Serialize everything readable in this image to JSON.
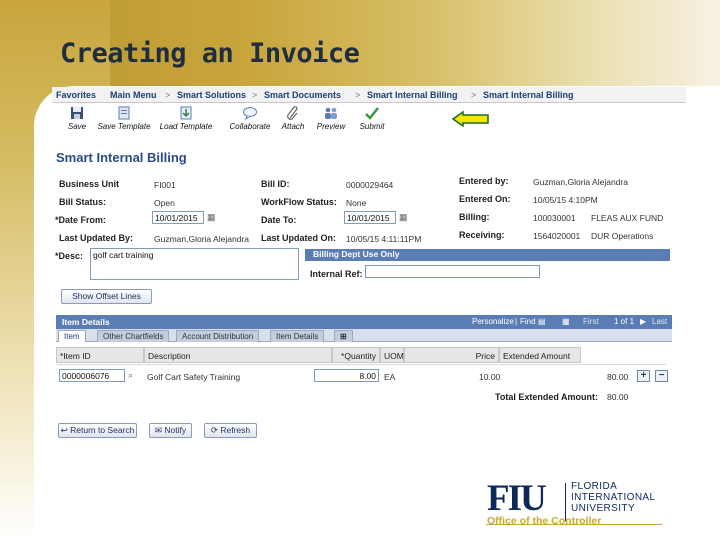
{
  "slide": {
    "title": "Creating an Invoice",
    "colors": {
      "gold": "#c9a63d",
      "navy": "#0b2a5b",
      "ps_blue": "#5b7db5",
      "arrow": "#f2e600"
    }
  },
  "breadcrumb": {
    "items": [
      "Favorites",
      "Main Menu",
      "Smart Solutions",
      "Smart Documents",
      "Smart Internal Billing",
      "Smart Internal Billing"
    ],
    "separator": ">"
  },
  "toolbar": {
    "items": [
      {
        "label": "Save",
        "icon": "disk-icon"
      },
      {
        "label": "Save Template",
        "icon": "save-template-icon"
      },
      {
        "label": "Load Template",
        "icon": "load-template-icon"
      },
      {
        "label": "Collaborate",
        "icon": "speech-bubble-icon"
      },
      {
        "label": "Attach",
        "icon": "paperclip-icon"
      },
      {
        "label": "Preview",
        "icon": "people-icon"
      },
      {
        "label": "Submit",
        "icon": "checkmark-icon"
      }
    ],
    "pointer": "yellow-arrow-icon"
  },
  "page": {
    "title": "Smart Internal Billing"
  },
  "header": {
    "business_unit": {
      "label": "Business Unit",
      "value": "FI001"
    },
    "bill_id": {
      "label": "Bill ID:",
      "value": "0000029464"
    },
    "entered_by": {
      "label": "Entered by:",
      "value": "Guzman,Gloria Alejandra"
    },
    "bill_status": {
      "label": "Bill Status:",
      "value": "Open"
    },
    "workflow_status": {
      "label": "WorkFlow Status:",
      "value": "None"
    },
    "entered_on": {
      "label": "Entered On:",
      "value": "10/05/15 4:10PM"
    },
    "date_from": {
      "label": "*Date From:",
      "value": "10/01/2015"
    },
    "date_to": {
      "label": "Date To:",
      "value": "10/01/2015"
    },
    "billing": {
      "label": "Billing:",
      "value": "100030001",
      "desc": "FLEAS AUX FUND"
    },
    "last_updated_by": {
      "label": "Last Updated By:",
      "value": "Guzman,Gloria Alejandra"
    },
    "last_updated_on": {
      "label": "Last Updated On:",
      "value": "10/05/15 4:11:11PM"
    },
    "receiving": {
      "label": "Receiving:",
      "value": "1564020001",
      "desc": "DUR Operations"
    },
    "desc": {
      "label": "*Desc:",
      "value": "golf cart training"
    }
  },
  "billing_dept": {
    "title": "Billing Dept Use Only",
    "internal_ref_label": "Internal Ref:",
    "internal_ref_value": ""
  },
  "buttons": {
    "show_offset": "Show Offset Lines",
    "return_search": "Return to Search",
    "notify": "Notify",
    "refresh": "Refresh"
  },
  "grid": {
    "title": "Item Details",
    "tools": {
      "personalize": "Personalize",
      "find": "Find",
      "first": "First",
      "range": "1 of 1",
      "last": "Last"
    },
    "tabs": [
      "Item",
      "Other Chartfields",
      "Account Distribution",
      "Item Details"
    ],
    "columns": [
      "*Item ID",
      "Description",
      "*Quantity",
      "UOM",
      "Price",
      "Extended Amount"
    ],
    "rows": [
      {
        "item_id": "0000006076",
        "description": "Golf Cart Safety Training",
        "quantity": "8.00",
        "uom": "EA",
        "price": "10.00",
        "extended": "80.00"
      }
    ],
    "total_label": "Total Extended Amount:",
    "total_value": "80.00"
  },
  "logo": {
    "mark": "FIU",
    "lines": [
      "FLORIDA",
      "INTERNATIONAL",
      "UNIVERSITY"
    ],
    "office": "Office of the Controller"
  }
}
